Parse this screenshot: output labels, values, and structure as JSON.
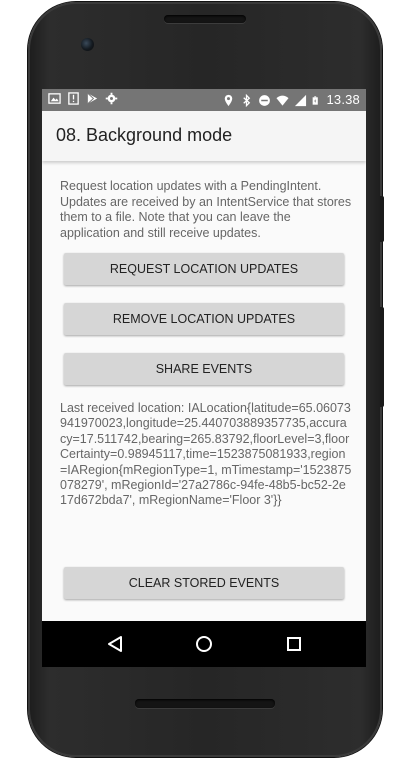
{
  "status_bar": {
    "time": "13.38",
    "left_icons": [
      "image-icon",
      "alert-icon",
      "play-store-icon",
      "settings-icon"
    ],
    "right_icons": [
      "location-icon",
      "bluetooth-icon",
      "do-not-disturb-icon",
      "wifi-icon",
      "signal-icon",
      "battery-icon"
    ]
  },
  "app_bar": {
    "title": "08. Background mode"
  },
  "content": {
    "description": "Request location updates with a PendingIntent. Updates are received by an IntentService that stores them to a file. Note that you can leave the application and still receive updates.",
    "buttons": {
      "request": "REQUEST LOCATION UPDATES",
      "remove": "REMOVE LOCATION UPDATES",
      "share": "SHARE EVENTS",
      "clear": "CLEAR STORED EVENTS"
    },
    "last_location": "Last received location: IALocation{latitude=65.06073941970023,longitude=25.440703889357735,accuracy=17.511742,bearing=265.83792,floorLevel=3,floorCertainty=0.98945117,time=1523875081933,region=IARegion{mRegionType=1, mTimestamp='1523875078279', mRegionId='27a2786c-94fe-48b5-bc52-2e17d672bda7', mRegionName='Floor 3'}}"
  },
  "nav_bar": {
    "icons": [
      "back-icon",
      "home-icon",
      "recents-icon"
    ]
  },
  "colors": {
    "status_bar": "#757575",
    "app_bar": "#f5f5f5",
    "button": "#d6d6d6",
    "body_text": "#666666",
    "phone_body": "#262626"
  }
}
